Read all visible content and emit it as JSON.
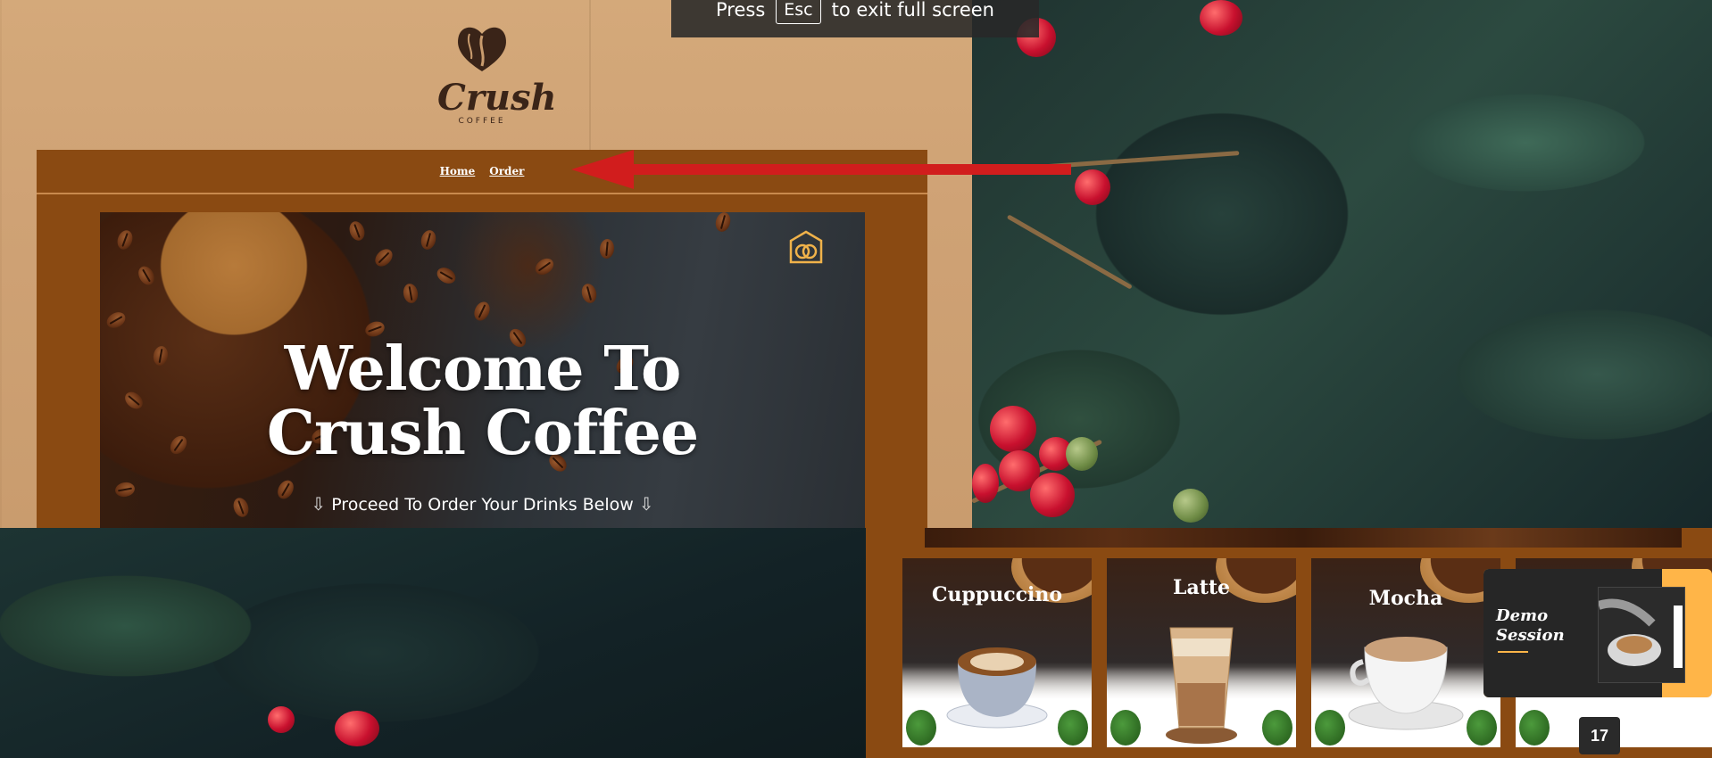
{
  "fullscreen_notice": {
    "press": "Press",
    "key": "Esc",
    "rest": "to exit full screen"
  },
  "logo": {
    "wordmark": "Crush",
    "subtitle": "COFFEE"
  },
  "nav": {
    "items": [
      {
        "label": "Home"
      },
      {
        "label": "Order"
      }
    ]
  },
  "hero": {
    "title_line1": "Welcome To",
    "title_line2": "Crush Coffee",
    "subtitle": "Proceed To Order Your Drinks Below",
    "icon": "coffee-brand-icon"
  },
  "products": [
    {
      "name": "Cuppuccino",
      "cup": "latte-art-cup"
    },
    {
      "name": "Latte",
      "cup": "iced-latte-glass"
    },
    {
      "name": "Mocha",
      "cup": "white-cup"
    }
  ],
  "demo_session": {
    "title_line1": "Demo",
    "title_line2": "Session"
  },
  "page_badge": "17",
  "colors": {
    "nav_brown": "#8a4a12",
    "kraft": "#d4a97a",
    "annotation_red": "#d11d1d",
    "demo_accent": "#ffb548"
  }
}
